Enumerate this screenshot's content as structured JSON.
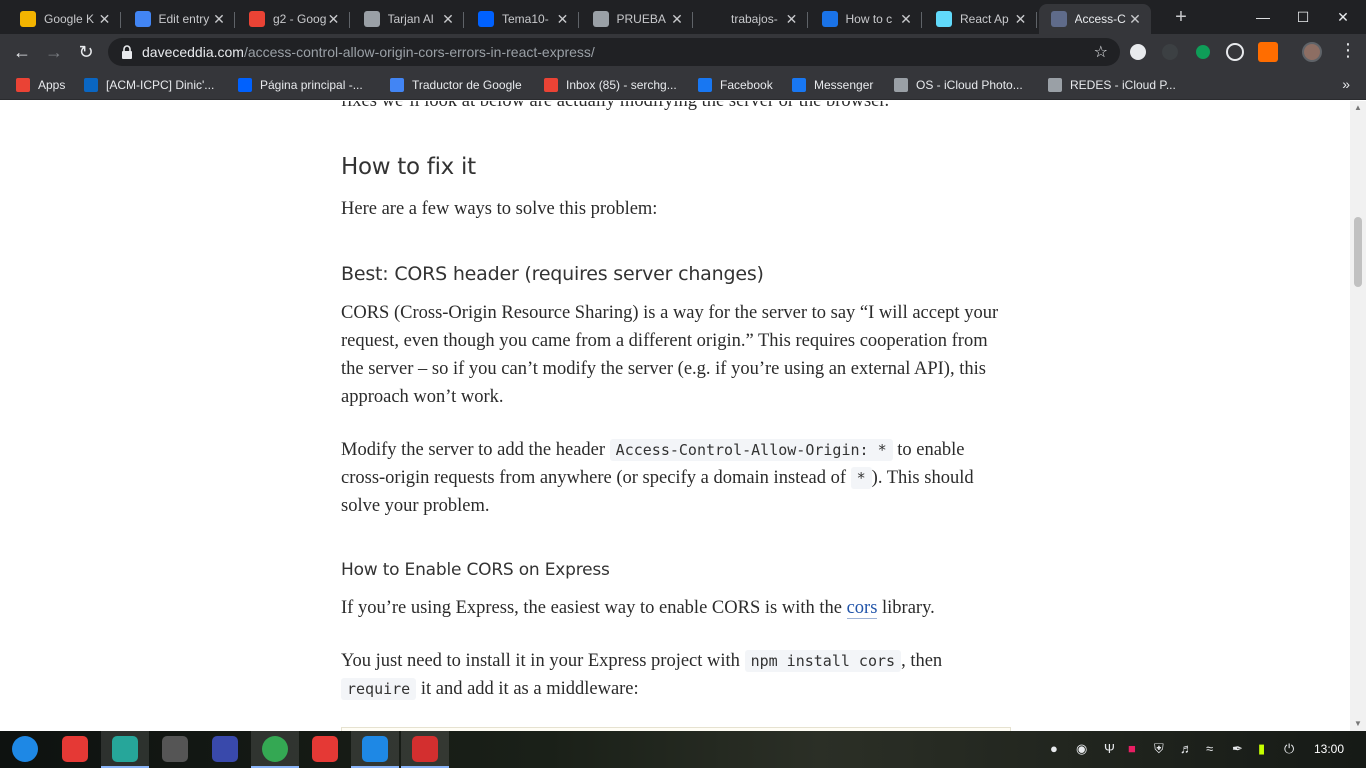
{
  "browser": {
    "tabs": [
      {
        "title": "Google K",
        "icon": "keep-icon",
        "color": "#f4b400"
      },
      {
        "title": "Edit entry",
        "icon": "chart-icon",
        "color": "#4285f4"
      },
      {
        "title": "g2 - Goog",
        "icon": "slides-icon",
        "color": "#ea4335"
      },
      {
        "title": "Tarjan Al",
        "icon": "globe-icon",
        "color": "#9aa0a6"
      },
      {
        "title": "Tema10-",
        "icon": "dropbox-icon",
        "color": "#0061fe"
      },
      {
        "title": "PRUEBA",
        "icon": "globe-icon",
        "color": "#9aa0a6"
      },
      {
        "title": "trabajos-",
        "icon": "github-icon",
        "color": "#202124"
      },
      {
        "title": "How to c",
        "icon": "freecodecamp-icon",
        "color": "#1a73e8"
      },
      {
        "title": "React Ap",
        "icon": "react-icon",
        "color": "#61dafb"
      },
      {
        "title": "Access-C",
        "icon": "dc-icon",
        "color": "#5f6b8a",
        "active": true
      }
    ],
    "address": {
      "host": "daveceddia.com",
      "path": "/access-control-allow-origin-cors-errors-in-react-express/"
    },
    "bookmarks": [
      {
        "label": "Apps",
        "icon": "apps-grid-icon",
        "color": "#ea4335"
      },
      {
        "label": "[ACM-ICPC] Dinic'...",
        "icon": "linkedin-icon",
        "color": "#0a66c2"
      },
      {
        "label": "Página principal -...",
        "icon": "dropbox-icon",
        "color": "#0061fe"
      },
      {
        "label": "Traductor de Google",
        "icon": "translate-icon",
        "color": "#4285f4"
      },
      {
        "label": "Inbox (85) - serchg...",
        "icon": "gmail-icon",
        "color": "#ea4335"
      },
      {
        "label": "Facebook",
        "icon": "facebook-icon",
        "color": "#1877f2"
      },
      {
        "label": "Messenger",
        "icon": "facebook-icon",
        "color": "#1877f2"
      },
      {
        "label": "OS - iCloud Photo...",
        "icon": "apple-icon",
        "color": "#9aa0a6"
      },
      {
        "label": "REDES - iCloud P...",
        "icon": "apple-icon",
        "color": "#9aa0a6"
      }
    ]
  },
  "article": {
    "cut_line": "fixes we’ll look at below are actually modifying the server or the browser.",
    "h_fix": "How to fix it",
    "p_intro": "Here are a few ways to solve this problem:",
    "h_best": "Best: CORS header (requires server changes)",
    "p_cors": "CORS (Cross-Origin Resource Sharing) is a way for the server to say “I will accept your request, even though you came from a different origin.” This requires cooperation from the server – so if you can’t modify the server (e.g. if you’re using an external API), this approach won’t work.",
    "p_modify_1": "Modify the server to add the header",
    "code_header": "Access-Control-Allow-Origin: *",
    "p_modify_2": "to enable cross-origin requests from anywhere (or specify a domain instead of",
    "code_star": "*",
    "p_modify_3": "). This should solve your problem.",
    "h_express": "How to Enable CORS on Express",
    "p_express_1": "If you’re using Express, the easiest way to enable CORS is with the",
    "link_cors": "cors",
    "p_express_2": "library.",
    "p_install_1": "You just need to install it in your Express project with",
    "code_install": "npm install cors",
    "p_install_2": ", then",
    "code_require": "require",
    "p_install_3": "it and add it as a middleware:"
  },
  "taskbar": {
    "clock": "13:00",
    "apps": [
      {
        "name": "launcher-icon",
        "color": "#1e88e5"
      },
      {
        "name": "record-icon",
        "color": "#e53935"
      },
      {
        "name": "store-icon",
        "color": "#26a69a"
      },
      {
        "name": "sublime-icon",
        "color": "#555555"
      },
      {
        "name": "monitor-icon",
        "color": "#3949ab"
      },
      {
        "name": "chrome-icon",
        "color": "#34a853"
      },
      {
        "name": "opera-icon",
        "color": "#e53935"
      },
      {
        "name": "vscode-icon",
        "color": "#1e88e5"
      },
      {
        "name": "terminal-icon",
        "color": "#d32f2f"
      }
    ]
  }
}
